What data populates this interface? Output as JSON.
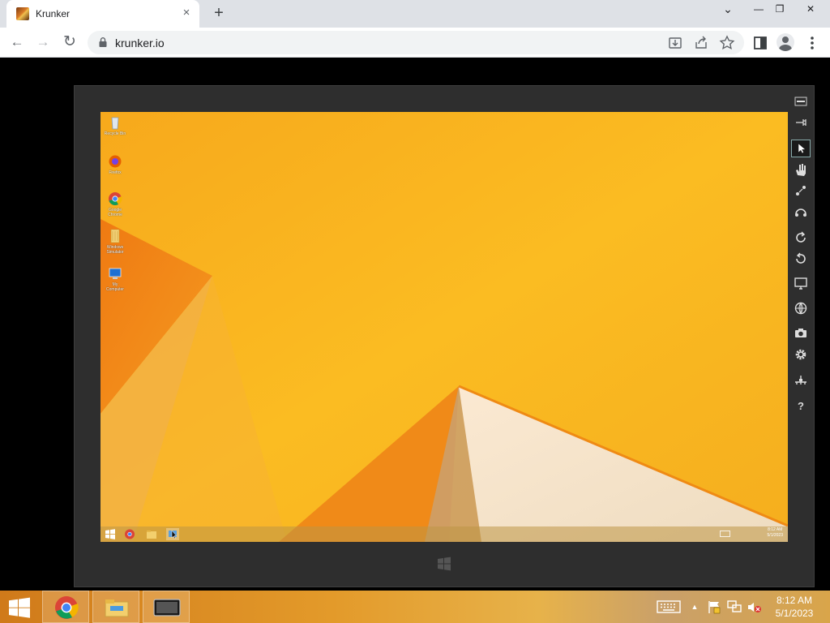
{
  "browser": {
    "tab_title": "Krunker",
    "url": "krunker.io",
    "tab_close_glyph": "×",
    "new_tab_glyph": "+",
    "window_controls": {
      "dropdown": "⌄",
      "minimize": "—",
      "restore": "❐",
      "close": "✕"
    }
  },
  "toolbar": {
    "back_glyph": "←",
    "forward_glyph": "→",
    "reload_glyph": "↻",
    "icons": [
      "install-icon",
      "share-icon",
      "bookmark-star-icon",
      "side-panel-icon",
      "profile-icon",
      "menu-icon"
    ]
  },
  "emulator": {
    "sidebar_buttons": [
      "minimize-icon",
      "pin-icon",
      "pointer-icon",
      "hand-icon",
      "pinch-icon",
      "rotate-gesture-icon",
      "rotate-clockwise-icon",
      "rotate-counterclockwise-icon",
      "monitor-icon",
      "globe-icon",
      "camera-icon",
      "settings-icon",
      "network-icon",
      "help-icon"
    ],
    "help_glyph": "?",
    "desktop_icons": [
      {
        "name": "Recycle Bin",
        "icon": "recycle-bin-icon"
      },
      {
        "name": "Firefox",
        "icon": "firefox-icon"
      },
      {
        "name": "Google Chrome",
        "icon": "chrome-icon"
      },
      {
        "name": "Windows Simulator",
        "icon": "folder-icon"
      },
      {
        "name": "My Computer",
        "icon": "computer-icon"
      }
    ],
    "inner_clock": {
      "time": "8:12 AM",
      "date": "5/1/2023"
    }
  },
  "taskbar": {
    "apps": [
      "chrome-icon",
      "file-explorer-icon",
      "simulator-icon"
    ],
    "tray": [
      "keyboard-icon",
      "show-hidden-icon",
      "action-center-flag-icon",
      "network-icon",
      "volume-muted-icon"
    ],
    "clock": {
      "time": "8:12 AM",
      "date": "5/1/2023"
    },
    "tray_chevron": "▲"
  },
  "colors": {
    "desktop_orange": "#f6a61a",
    "desktop_yellow": "#fbbf24",
    "emulator_frame": "#2e2e2e",
    "taskbar": "#d88a22"
  }
}
